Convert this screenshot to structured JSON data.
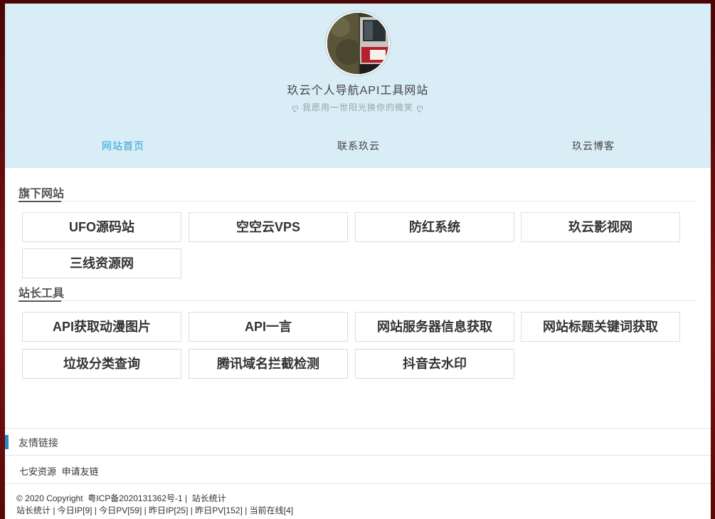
{
  "header": {
    "title": "玖云个人导航API工具网站",
    "subtitle": "ღ 我愿用一世阳光换你的微笑 ღ",
    "avatar_icon": "avatar-photo-icon"
  },
  "nav": {
    "items": [
      {
        "label": "网站首页"
      },
      {
        "label": "联系玖云"
      },
      {
        "label": "玖云博客"
      }
    ]
  },
  "sections": [
    {
      "title": "旗下网站",
      "cards": [
        "UFO源码站",
        "空空云VPS",
        "防红系统",
        "玖云影视网",
        "三线资源网"
      ]
    },
    {
      "title": "站长工具",
      "cards": [
        "API获取动漫图片",
        "API一言",
        "网站服务器信息获取",
        "网站标题关键词获取",
        "垃圾分类查询",
        "腾讯域名拦截检测",
        "抖音去水印"
      ]
    }
  ],
  "friends": {
    "title": "友情链接",
    "links": [
      "七安资源",
      "申请友链"
    ]
  },
  "footer": {
    "copyright": "© 2020 Copyright",
    "icp": "粤ICP备2020131362号-1",
    "sep": "|",
    "stats_link": "站长统计",
    "stats_line": "站长统计 | 今日IP[9] | 今日PV[59] | 昨日IP[25] | 昨日PV[152] | 当前在线[4]"
  },
  "colors": {
    "hero_bg": "#d9edf7",
    "nav_active": "#2aa3d8",
    "accent_bar": "#2a88c8"
  }
}
